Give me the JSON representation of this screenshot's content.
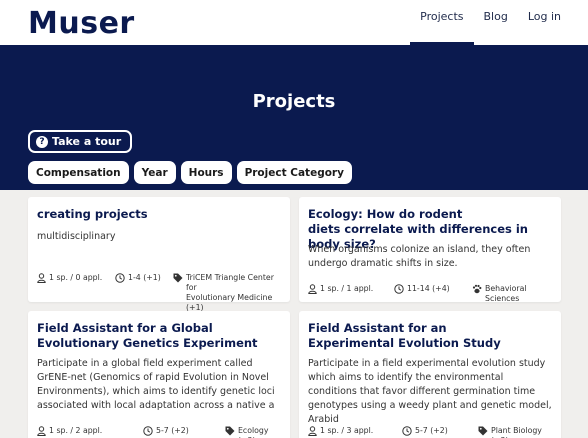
{
  "app": {
    "logo": "Muser"
  },
  "nav": [
    {
      "label": "Projects",
      "active": true
    },
    {
      "label": "Blog",
      "active": false
    },
    {
      "label": "Log in",
      "active": false
    }
  ],
  "hero": {
    "title": "Projects",
    "tour_label": "Take a tour",
    "filters": [
      "Compensation",
      "Year",
      "Hours",
      "Project Category"
    ]
  },
  "projects": [
    {
      "title": "creating projects",
      "description": "multidisciplinary",
      "applicants": "1 sp. / 0 appl.",
      "hours": "1-4 (+1)",
      "category": "TriCEM Triangle Center for\nEvolutionary Medicine (+1)"
    },
    {
      "title": "Ecology: How do rodent\ndiets correlate with differences in body size?",
      "description": "When organisms colonize an island, they often undergo dramatic shifts in size.",
      "applicants": "1 sp. / 1 appl.",
      "hours": "11-14 (+4)",
      "category": "Behavioral Sciences"
    },
    {
      "title": "Field Assistant for a Global\nEvolutionary Genetics Experiment",
      "description": "Participate in a global field experiment called GrENE-net (Genomics of rapid Evolution in Novel Environments), which aims to identify genetic loci associated with local adaptation across a native a",
      "applicants": "1 sp. / 2 appl.",
      "hours": "5-7 (+2)",
      "category": "Ecology (+2)"
    },
    {
      "title": "Field Assistant for an\nExperimental Evolution Study",
      "description": "Participate in a field experimental evolution study which aims to identify the environmental conditions that favor different germination time genotypes using a weedy plant and genetic model, Arabid",
      "applicants": "1 sp. / 3 appl.",
      "hours": "5-7 (+2)",
      "category": "Plant Biology (+2)"
    }
  ]
}
